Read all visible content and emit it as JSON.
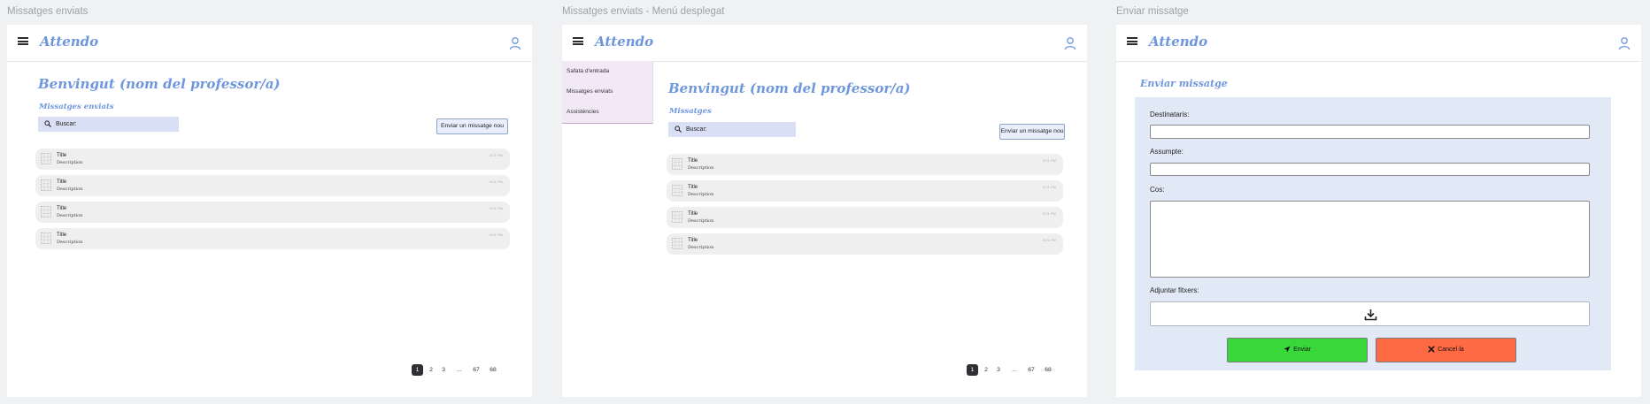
{
  "frames": {
    "sent": {
      "label": "Missatges enviats",
      "logo": "Attendo",
      "welcome": "Benvingut (nom del professor/a)",
      "section": "Missatges enviats",
      "search_label": "Buscar:",
      "new_message": "Enviar un missatge nou",
      "items": [
        {
          "title": "Title",
          "description": "Description",
          "meta": "8:01 PM"
        },
        {
          "title": "Title",
          "description": "Description",
          "meta": "8:01 PM"
        },
        {
          "title": "Title",
          "description": "Description",
          "meta": "8:01 PM"
        },
        {
          "title": "Title",
          "description": "Description",
          "meta": "8:01 PM"
        }
      ],
      "pagination": [
        "1",
        "2",
        "3",
        "...",
        "67",
        "68"
      ]
    },
    "menu": {
      "label": "Missatges enviats - Menú desplegat",
      "logo": "Attendo",
      "welcome": "Benvingut (nom del professor/a)",
      "section": "Missatges",
      "search_label": "Buscar:",
      "new_message": "Enviar un missatge nou",
      "drawer": [
        "Safata d'entrada",
        "Missatges enviats",
        "Assistències"
      ],
      "items": [
        {
          "title": "Title",
          "description": "Description",
          "meta": "8:01 PM"
        },
        {
          "title": "Title",
          "description": "Description",
          "meta": "8:01 PM"
        },
        {
          "title": "Title",
          "description": "Description",
          "meta": "8:01 PM"
        },
        {
          "title": "Title",
          "description": "Description",
          "meta": "8:01 PM"
        }
      ],
      "pagination": [
        "1",
        "2",
        "3",
        "...",
        "67",
        "68"
      ]
    },
    "compose": {
      "label": "Enviar missatge",
      "logo": "Attendo",
      "title": "Enviar missatge",
      "recipients_label": "Destinataris:",
      "subject_label": "Assumpte:",
      "body_label": "Cos:",
      "attach_label": "Adjuntar fitxers:",
      "send": "Enviar",
      "cancel": "Cancel·la"
    }
  },
  "icons": {
    "menu": "hamburger-icon",
    "user": "user-icon",
    "search": "search-icon",
    "item": "image-placeholder-icon",
    "download": "download-icon",
    "send": "send-icon",
    "close": "close-icon"
  },
  "colors": {
    "brand": "#6f97de",
    "search_bg": "#d9e0f5",
    "form_bg": "#e2e9f6",
    "send_bg": "#38d83a",
    "cancel_bg": "#fd6a43",
    "drawer_bg": "#f1e9f6",
    "pager_active": "#2f3033"
  }
}
